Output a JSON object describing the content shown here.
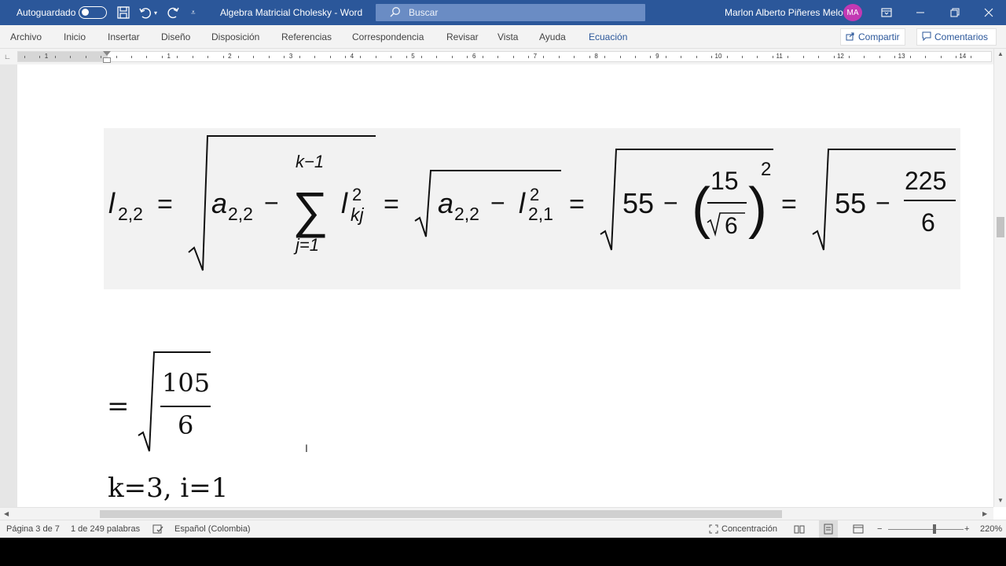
{
  "titlebar": {
    "autosave_label": "Autoguardado",
    "doc_title": "Algebra Matricial Cholesky  -  Word",
    "search_placeholder": "Buscar",
    "user_name": "Marlon Alberto Piñeres Melo",
    "user_initials": "MA",
    "avatar_color": "#c239b3",
    "accent_color": "#2b579a"
  },
  "menu": {
    "tabs": [
      "Archivo",
      "Inicio",
      "Insertar",
      "Diseño",
      "Disposición",
      "Referencias",
      "Correspondencia",
      "Revisar",
      "Vista",
      "Ayuda",
      "Ecuación"
    ],
    "active_tab": "Ecuación",
    "share_label": "Compartir",
    "comments_label": "Comentarios"
  },
  "ruler": {
    "numbers": [
      "1",
      "1",
      "2",
      "3",
      "4",
      "5",
      "6",
      "7",
      "8",
      "9",
      "10",
      "11",
      "12",
      "13",
      "14"
    ]
  },
  "document": {
    "equation_main": {
      "lhs_base": "l",
      "lhs_sub": "2,2",
      "term_a_sub": "2,2",
      "sum_upper": "k−1",
      "sum_lower": "j=1",
      "l_sup": "2",
      "l_sub": "kj",
      "term_l21_sub": "2,1",
      "const": "55",
      "frac_num": "15",
      "frac_den_radicand": "6",
      "exponent": "2",
      "frac2_num": "225",
      "frac2_den": "6"
    },
    "equation_result": {
      "num": "105",
      "den": "6"
    },
    "next_line": "k=3, i=1"
  },
  "status": {
    "page": "Página 3 de 7",
    "words": "1 de 249 palabras",
    "language": "Español (Colombia)",
    "focus": "Concentración",
    "zoom": "220%",
    "zoom_percent": 220
  }
}
